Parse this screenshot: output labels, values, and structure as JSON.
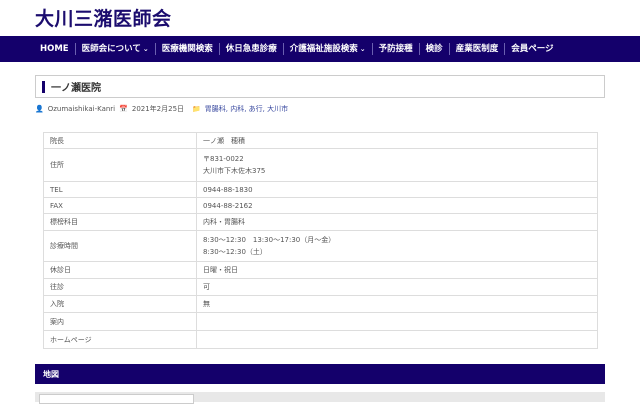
{
  "site_title": "大川三潴医師会",
  "nav": [
    {
      "label": "HOME"
    },
    {
      "label": "医師会について",
      "dropdown": true
    },
    {
      "label": "医療機関検索"
    },
    {
      "label": "休日急患診療"
    },
    {
      "label": "介護福祉施設検索",
      "dropdown": true
    },
    {
      "label": "予防接種"
    },
    {
      "label": "検診"
    },
    {
      "label": "産業医制度"
    },
    {
      "label": "会員ページ"
    }
  ],
  "page_title": "一ノ瀬医院",
  "meta": {
    "author": "Ozumaishikai-Kanri",
    "date": "2021年2月25日",
    "categories": "胃腸科, 内科, あ行, 大川市"
  },
  "rows": [
    {
      "key": "院長",
      "lines": [
        "一ノ瀬　穂積"
      ]
    },
    {
      "key": "住所",
      "lines": [
        "〒831-0022",
        "大川市下木佐木375"
      ]
    },
    {
      "key": "TEL",
      "lines": [
        "0944-88-1830"
      ]
    },
    {
      "key": "FAX",
      "lines": [
        "0944-88-2162"
      ]
    },
    {
      "key": "標榜科目",
      "lines": [
        "内科・胃腸科"
      ]
    },
    {
      "key": "診療時間",
      "lines": [
        "8:30〜12:30　13:30〜17:30（月〜金）",
        "8:30〜12:30（土）"
      ]
    },
    {
      "key": "休診日",
      "lines": [
        "日曜・祝日"
      ]
    },
    {
      "key": "往診",
      "lines": [
        "可"
      ]
    },
    {
      "key": "入院",
      "lines": [
        "無"
      ]
    },
    {
      "key": "案内",
      "lines": [
        ""
      ]
    },
    {
      "key": "ホームページ",
      "lines": [
        ""
      ]
    }
  ],
  "map_heading": "地図"
}
